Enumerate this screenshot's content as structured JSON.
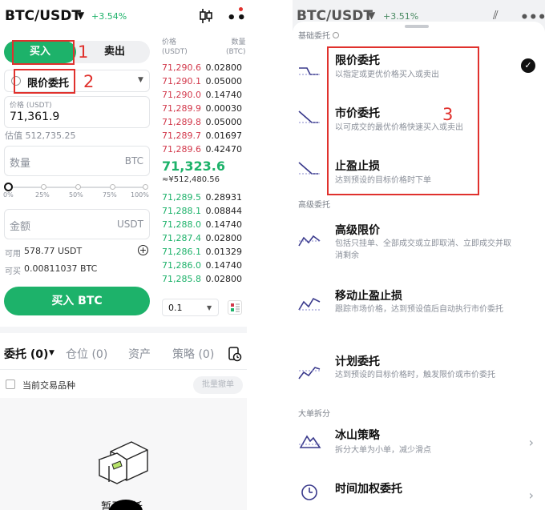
{
  "left": {
    "pair": "BTC/USDT",
    "change": "+3.54%",
    "buy_tab": "买入",
    "sell_tab": "卖出",
    "order_type": "限价委托",
    "price_label": "价格 (USDT)",
    "price_value": "71,361.9",
    "estimate": "估值 512,735.25",
    "qty_placeholder": "数量",
    "qty_unit": "BTC",
    "slider_ticks": [
      "0%",
      "25%",
      "50%",
      "75%",
      "100%"
    ],
    "amount_placeholder": "金额",
    "amount_unit": "USDT",
    "available_label": "可用",
    "available_value": "578.77 USDT",
    "buyable_label": "可买",
    "buyable_value": "0.00811037 BTC",
    "buy_button": "买入 BTC",
    "ob_price_header": "价格\n(USDT)",
    "ob_amount_header": "数量\n(BTC)",
    "asks": [
      {
        "price": "71,290.6",
        "amount": "0.02800"
      },
      {
        "price": "71,290.1",
        "amount": "0.05000"
      },
      {
        "price": "71,290.0",
        "amount": "0.14740"
      },
      {
        "price": "71,289.9",
        "amount": "0.00030"
      },
      {
        "price": "71,289.8",
        "amount": "0.05000"
      },
      {
        "price": "71,289.7",
        "amount": "0.01697"
      },
      {
        "price": "71,289.6",
        "amount": "0.42470"
      }
    ],
    "mid_price": "71,323.6",
    "mid_cny": "≈¥512,480.56",
    "bids": [
      {
        "price": "71,289.5",
        "amount": "0.28931"
      },
      {
        "price": "71,288.1",
        "amount": "0.08844"
      },
      {
        "price": "71,288.0",
        "amount": "0.14740"
      },
      {
        "price": "71,287.4",
        "amount": "0.02800"
      },
      {
        "price": "71,286.1",
        "amount": "0.01329"
      },
      {
        "price": "71,286.0",
        "amount": "0.14740"
      },
      {
        "price": "71,285.8",
        "amount": "0.02800"
      }
    ],
    "depth_select": "0.1",
    "bottom_tabs": [
      "委托 (0)",
      "仓位 (0)",
      "资产",
      "策略 (0)"
    ],
    "current_pair_only": "当前交易品种",
    "batch_cancel": "批量撤单",
    "empty_text": "暂无委托"
  },
  "right": {
    "pair": "BTC/USDT",
    "change": "+3.51%",
    "section_basic": "基础委托",
    "section_advanced": "高级委托",
    "section_large": "大单拆分",
    "items": [
      {
        "title": "限价委托",
        "desc": "以指定或更优价格买入或卖出"
      },
      {
        "title": "市价委托",
        "desc": "以可成交的最优价格快速买入或卖出"
      },
      {
        "title": "止盈止损",
        "desc": "达到预设的目标价格时下单"
      },
      {
        "title": "高级限价",
        "desc": "包括只挂单、全部成交或立即取消、立即成交并取消剩余"
      },
      {
        "title": "移动止盈止损",
        "desc": "跟踪市场价格，达到预设值后自动执行市价委托"
      },
      {
        "title": "计划委托",
        "desc": "达到预设的目标价格时，触发限价或市价委托"
      },
      {
        "title": "冰山策略",
        "desc": "拆分大单为小单，减少滑点"
      },
      {
        "title": "时间加权委托",
        "desc": ""
      }
    ]
  },
  "annotations": [
    "1",
    "2",
    "3"
  ],
  "colors": {
    "green": "#1db26a",
    "red": "#d2384b",
    "annotation": "#e0312d"
  }
}
